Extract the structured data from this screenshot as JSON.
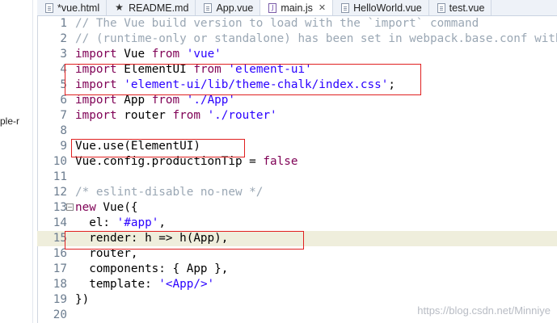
{
  "left_panel": {
    "fragment": "ple-r"
  },
  "tabs": [
    {
      "label": "*vue.html",
      "icon": "html-file-icon",
      "active": false
    },
    {
      "label": "README.md",
      "icon": "star-icon",
      "active": false
    },
    {
      "label": "App.vue",
      "icon": "vue-file-icon",
      "active": false
    },
    {
      "label": "main.js",
      "icon": "js-file-icon",
      "active": true,
      "close": "✕"
    },
    {
      "label": "HelloWorld.vue",
      "icon": "vue-file-icon",
      "active": false
    },
    {
      "label": "test.vue",
      "icon": "vue-file-icon",
      "active": false
    }
  ],
  "editor": {
    "lines": [
      {
        "n": "1",
        "segs": [
          [
            "c",
            "// The Vue build version to load with the `import` command"
          ]
        ]
      },
      {
        "n": "2",
        "segs": [
          [
            "c",
            "// (runtime-only or standalone) has been set in webpack.base.conf with an alias."
          ]
        ]
      },
      {
        "n": "3",
        "segs": [
          [
            "k",
            "import"
          ],
          [
            "o",
            " Vue "
          ],
          [
            "k",
            "from"
          ],
          [
            "o",
            " "
          ],
          [
            "s",
            "'vue'"
          ]
        ]
      },
      {
        "n": "4",
        "segs": [
          [
            "k",
            "import"
          ],
          [
            "o",
            " ElementUI "
          ],
          [
            "k",
            "from"
          ],
          [
            "o",
            " "
          ],
          [
            "s",
            "'element-ui'"
          ]
        ]
      },
      {
        "n": "5",
        "segs": [
          [
            "k",
            "import"
          ],
          [
            "o",
            " "
          ],
          [
            "s",
            "'element-ui/lib/theme-chalk/index.css'"
          ],
          [
            "o",
            ";"
          ]
        ]
      },
      {
        "n": "6",
        "segs": [
          [
            "k",
            "import"
          ],
          [
            "o",
            " App "
          ],
          [
            "k",
            "from"
          ],
          [
            "o",
            " "
          ],
          [
            "s",
            "'./App'"
          ]
        ]
      },
      {
        "n": "7",
        "segs": [
          [
            "k",
            "import"
          ],
          [
            "o",
            " router "
          ],
          [
            "k",
            "from"
          ],
          [
            "o",
            " "
          ],
          [
            "s",
            "'./router'"
          ]
        ]
      },
      {
        "n": "8",
        "segs": []
      },
      {
        "n": "9",
        "segs": [
          [
            "o",
            "Vue.use(ElementUI)"
          ]
        ]
      },
      {
        "n": "10",
        "segs": [
          [
            "o",
            "Vue.config.productionTip = "
          ],
          [
            "b",
            "false"
          ]
        ]
      },
      {
        "n": "11",
        "segs": []
      },
      {
        "n": "12",
        "segs": [
          [
            "c",
            "/* eslint-disable no-new */"
          ]
        ]
      },
      {
        "n": "13",
        "segs": [
          [
            "k",
            "new"
          ],
          [
            "o",
            " Vue({"
          ]
        ],
        "fold": "−"
      },
      {
        "n": "14",
        "segs": [
          [
            "o",
            "  el: "
          ],
          [
            "s",
            "'#app'"
          ],
          [
            "o",
            ","
          ]
        ]
      },
      {
        "n": "15",
        "segs": [
          [
            "o",
            "  render: h => h(App),"
          ]
        ],
        "current": true
      },
      {
        "n": "16",
        "segs": [
          [
            "o",
            "  router,"
          ]
        ]
      },
      {
        "n": "17",
        "segs": [
          [
            "o",
            "  components: { App },"
          ]
        ]
      },
      {
        "n": "18",
        "segs": [
          [
            "o",
            "  template: "
          ],
          [
            "s",
            "'<App/>'"
          ]
        ]
      },
      {
        "n": "19",
        "segs": [
          [
            "o",
            "})"
          ]
        ]
      },
      {
        "n": "20",
        "segs": []
      }
    ]
  },
  "watermark": "https://blog.csdn.net/Minniye"
}
